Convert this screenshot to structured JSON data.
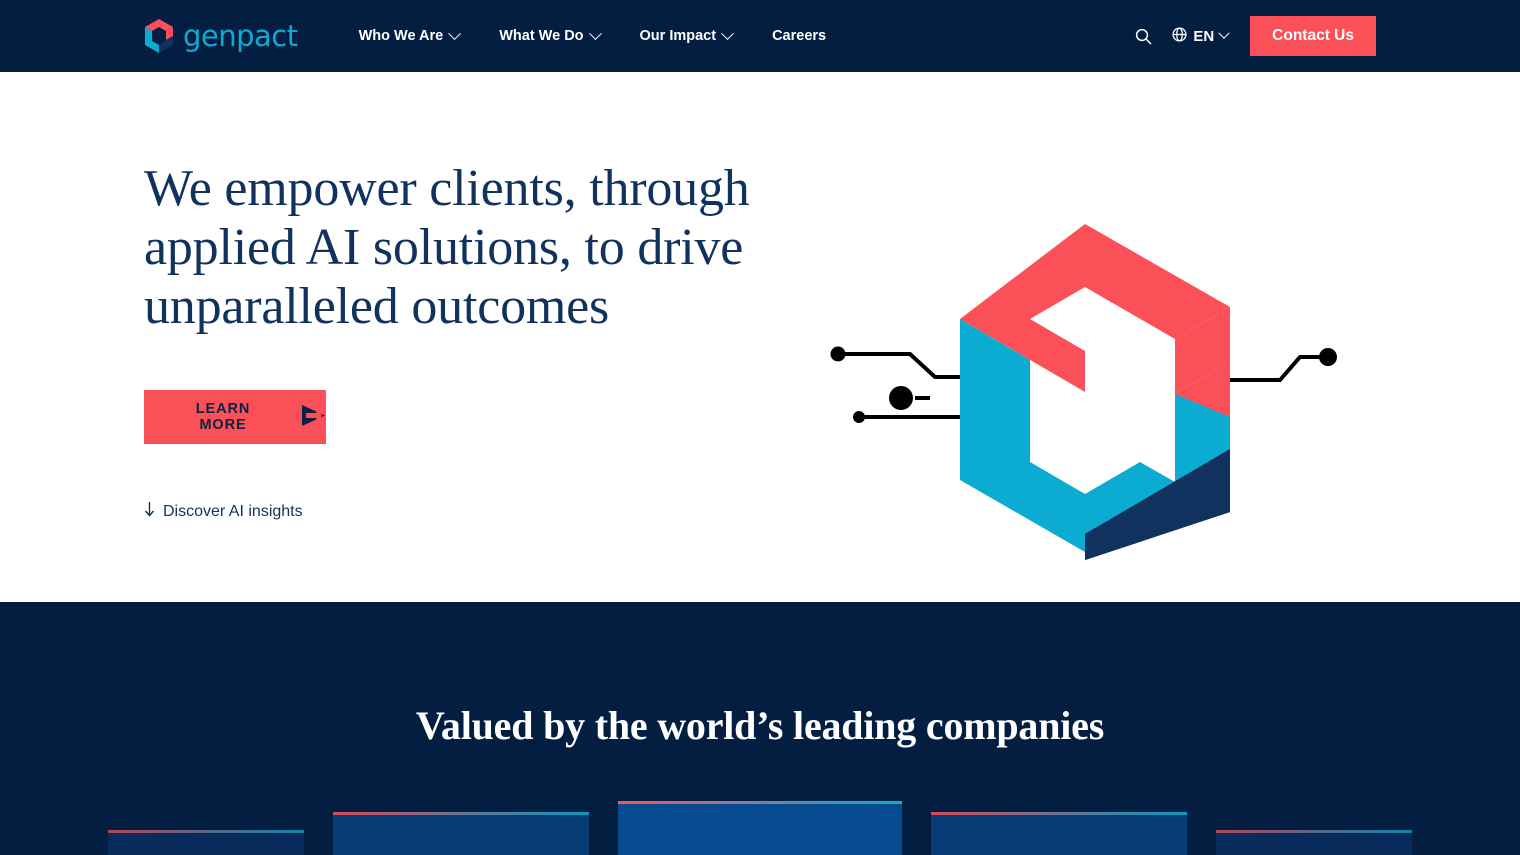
{
  "brand": {
    "name": "genpact",
    "logo_icon": "genpact-cube-logo",
    "accent_red": "#fb5058",
    "accent_cyan": "#0cabd2",
    "navy": "#041e42",
    "heading_navy": "#11325f"
  },
  "header": {
    "nav_items": [
      {
        "label": "Who We Are",
        "has_dropdown": true
      },
      {
        "label": "What We Do",
        "has_dropdown": true
      },
      {
        "label": "Our Impact",
        "has_dropdown": true
      },
      {
        "label": "Careers",
        "has_dropdown": false
      }
    ],
    "search_icon": "search-icon",
    "language": {
      "icon": "globe-icon",
      "value": "EN"
    },
    "contact_label": "Contact Us"
  },
  "hero": {
    "title": "We empower clients, through applied AI solutions, to drive unparalleled outcomes",
    "cta_label": "LEARN MORE",
    "cta_icon": "play-arrow-icon",
    "scroll_link": {
      "icon": "arrow-down-icon",
      "label": "Discover AI insights"
    },
    "artwork": {
      "name": "isometric-cube-circuit-graphic",
      "colors": {
        "top": "#fb5058",
        "left": "#0cabd2",
        "right": "#11325f",
        "circuit": "#000000"
      }
    }
  },
  "valued": {
    "heading": "Valued by the world’s leading companies",
    "cards": [
      {
        "name": "logo-card-1"
      },
      {
        "name": "logo-card-2"
      },
      {
        "name": "logo-card-3"
      },
      {
        "name": "logo-card-4"
      },
      {
        "name": "logo-card-5"
      }
    ]
  }
}
